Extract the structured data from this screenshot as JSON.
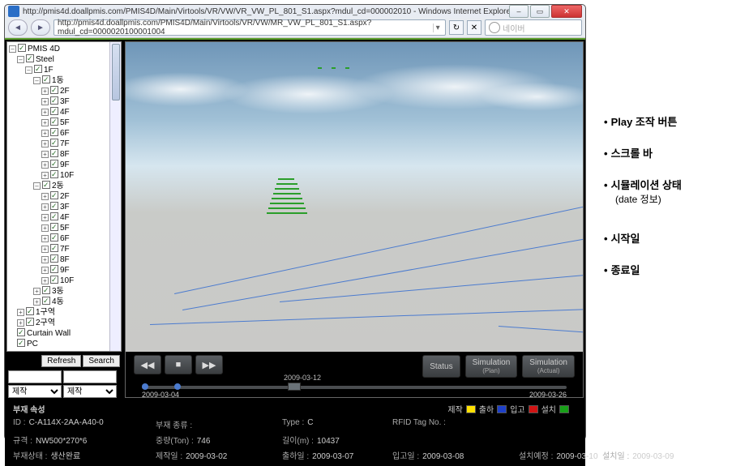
{
  "browser": {
    "title": "http://pmis4d.doallpmis.com/PMIS4D/Main/Virtools/VR/VW/VR_VW_PL_801_S1.aspx?mdul_cd=000002010 - Windows Internet Explorer",
    "url": "http://pmis4d.doallpmis.com/PMIS4D/Main/Virtools/VR/VW/MR_VW_PL_801_S1.aspx?mdul_cd=0000020100001004",
    "search_placeholder": "네이버"
  },
  "tree": {
    "root": "PMIS 4D",
    "level2": "Steel",
    "level3a": "1F",
    "b1": "1동",
    "floors1": [
      "2F",
      "3F",
      "4F",
      "5F",
      "6F",
      "7F",
      "8F",
      "9F",
      "10F"
    ],
    "b2": "2동",
    "floors2": [
      "2F",
      "3F",
      "4F",
      "5F",
      "6F",
      "7F",
      "8F",
      "9F",
      "10F"
    ],
    "b3": "3동",
    "b4": "4동",
    "zone1": "1구역",
    "zone2": "2구역",
    "cw": "Curtain Wall",
    "pc": "PC",
    "refresh": "Refresh",
    "search": "Search",
    "filter1": "제작",
    "filter2": "제작"
  },
  "buttons": {
    "status": "Status",
    "sim_plan": "Simulation",
    "sim_plan_sub": "(Plan)",
    "sim_actual": "Simulation",
    "sim_actual_sub": "(Actual)"
  },
  "timeline": {
    "mid_date": "2009-03-12",
    "start_date": "2009-03-04",
    "end_date": "2009-03-26"
  },
  "detail": {
    "title": "부재 속성",
    "legend": {
      "l1": "제작",
      "l2": "출하",
      "l3": "입고",
      "l4": "설치"
    },
    "id_label": "ID :",
    "id_val": "C-A114X-2AA-A40-0",
    "kind_label": "부재 종류 :",
    "kind_val": "",
    "type_label": "Type :",
    "type_val": "C",
    "rfid_label": "RFID Tag No. :",
    "rfid_val": "",
    "spec_label": "규격 :",
    "spec_val": "NW500*270*6",
    "weight_label": "중량(Ton) :",
    "weight_val": "746",
    "len_label": "길이(m) :",
    "len_val": "10437",
    "status_label": "부재상태 :",
    "status_val": "생산완료",
    "mfg_label": "제작일 :",
    "mfg_val": "2009-03-02",
    "ship_label": "출하일 :",
    "ship_val": "2009-03-07",
    "in_label": "입고일 :",
    "in_val": "2009-03-08",
    "plan_label": "설치예정 :",
    "plan_val": "2009-03-10",
    "inst_label": "설치일 :",
    "inst_val": "2009-03-09"
  },
  "annotations": {
    "a1": "Play 조작 버튼",
    "a2": "스크롤 바",
    "a3": "시뮬레이션 상태",
    "a3sub": "(date 정보)",
    "a4": "시작일",
    "a5": "종료일"
  }
}
